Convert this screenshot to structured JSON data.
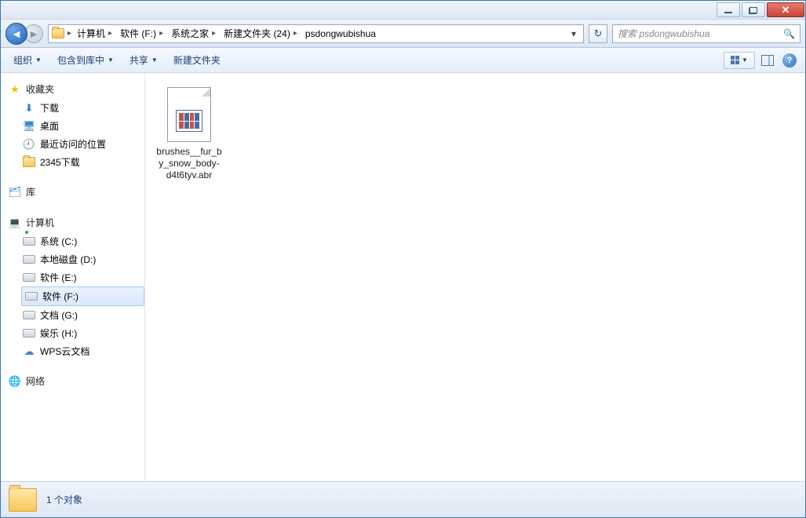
{
  "titlebar": {},
  "breadcrumbs": {
    "root": "计算机",
    "d1": "软件 (F:)",
    "d2": "系统之家",
    "d3": "新建文件夹 (24)",
    "d4": "psdongwubishua"
  },
  "search": {
    "placeholder": "搜索 psdongwubishua"
  },
  "toolbar": {
    "organize": "组织",
    "include": "包含到库中",
    "share": "共享",
    "newfolder": "新建文件夹"
  },
  "sidebar": {
    "favorites": "收藏夹",
    "fav_items": {
      "downloads": "下载",
      "desktop": "桌面",
      "recent": "最近访问的位置",
      "dl2345": "2345下载"
    },
    "libraries": "库",
    "computer": "计算机",
    "drives": {
      "c": "系统 (C:)",
      "d": "本地磁盘 (D:)",
      "e": "软件 (E:)",
      "f": "软件 (F:)",
      "g": "文档 (G:)",
      "h": "娱乐 (H:)",
      "wps": "WPS云文档"
    },
    "network": "网络"
  },
  "files": [
    {
      "name": "brushes__fur_by_snow_body-d4t6tyv.abr"
    }
  ],
  "status": {
    "text": "1 个对象"
  }
}
